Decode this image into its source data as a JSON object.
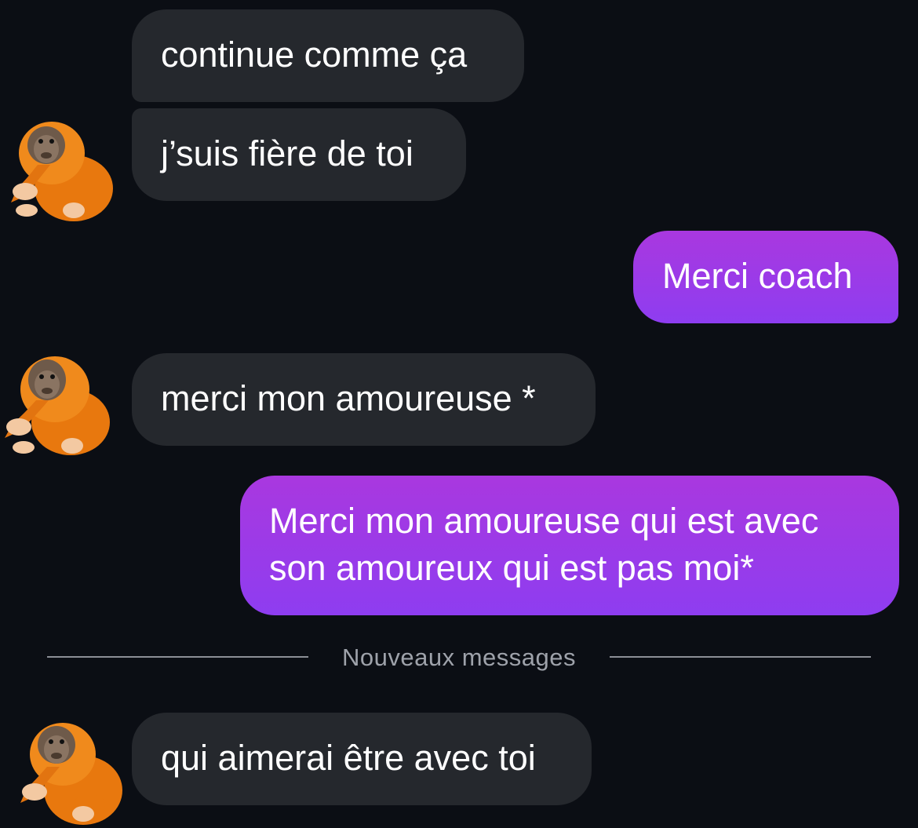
{
  "messages": [
    {
      "from": "coach",
      "text": "continue comme ça"
    },
    {
      "from": "coach",
      "text": "j’suis fière de toi"
    },
    {
      "from": "me",
      "text": "Merci coach"
    },
    {
      "from": "coach",
      "text": "merci mon amoureuse *"
    },
    {
      "from": "me",
      "lines": [
        "Merci mon amoureuse qui est avec",
        "son amoureux qui est pas moi*"
      ]
    },
    {
      "from": "coach",
      "text": "qui aimerai être avec toi"
    }
  ],
  "divider": {
    "label": "Nouveaux messages"
  },
  "colors": {
    "background": "#0b0e14",
    "received_bubble": "#25282d",
    "sent_bubble_top": "#a938df",
    "sent_bubble_bottom": "#8e3df0",
    "text": "#ffffff",
    "divider": "#8c8f96"
  },
  "avatar": {
    "icon": "orangutan-avatar-icon"
  }
}
